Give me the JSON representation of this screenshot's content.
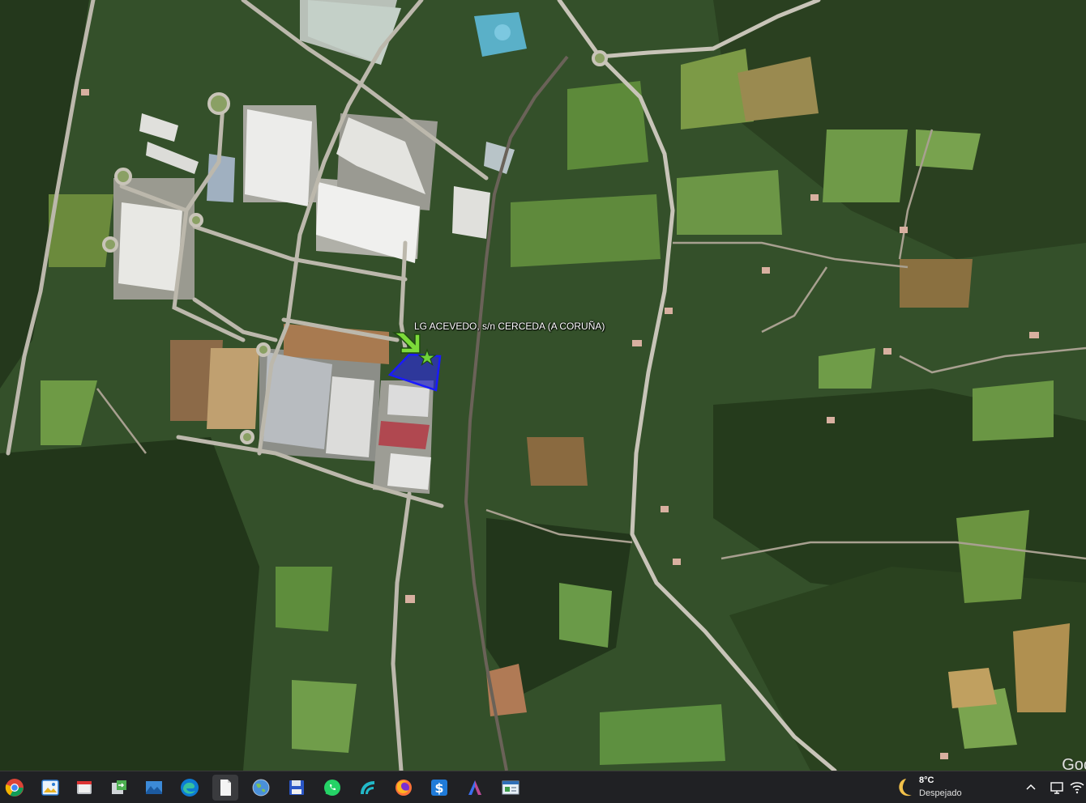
{
  "map": {
    "placemark_label": "LG ACEVEDO, s/n CERCEDA (A CORUÑA)",
    "watermark": "Goo",
    "colors": {
      "polygon_fill": "#2b2bd9",
      "polygon_stroke": "#1a1aff",
      "arrow": "#7ddb3a",
      "star": "#6fd33a"
    }
  },
  "taskbar": {
    "apps": [
      {
        "name": "chrome-icon",
        "active": false
      },
      {
        "name": "photos-icon",
        "active": false
      },
      {
        "name": "file-explorer-icon",
        "active": false
      },
      {
        "name": "transfer-icon",
        "active": false
      },
      {
        "name": "landscape-image-icon",
        "active": false
      },
      {
        "name": "edge-icon",
        "active": false
      },
      {
        "name": "document-icon",
        "active": true
      },
      {
        "name": "google-earth-icon",
        "active": false
      },
      {
        "name": "floppy-disk-icon",
        "active": false
      },
      {
        "name": "whatsapp-icon",
        "active": false
      },
      {
        "name": "wave-app-icon",
        "active": false
      },
      {
        "name": "firefox-icon",
        "active": false
      },
      {
        "name": "s-app-icon",
        "active": false
      },
      {
        "name": "a-app-icon",
        "active": false
      },
      {
        "name": "window-app-icon",
        "active": false
      }
    ],
    "weather": {
      "temperature": "8°C",
      "condition": "Despejado",
      "icon": "moon-icon"
    },
    "tray_icons": [
      "chevron-up-icon",
      "display-icon",
      "wifi-icon"
    ]
  }
}
